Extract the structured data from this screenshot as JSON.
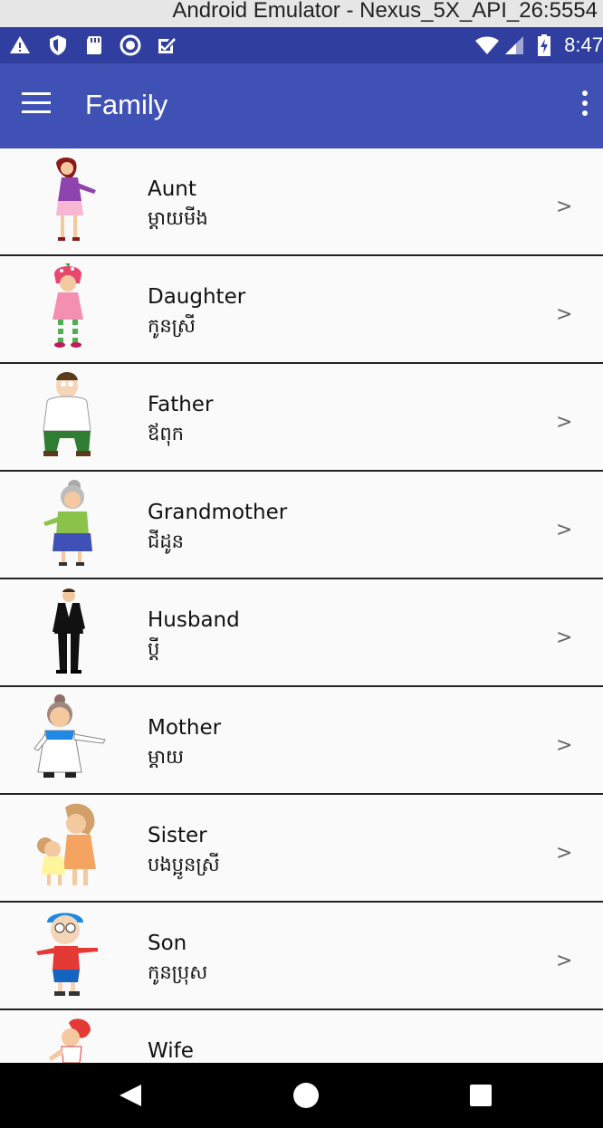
{
  "window": {
    "title": "Android Emulator - Nexus_5X_API_26:5554"
  },
  "status_bar": {
    "time": "8:47",
    "left_icons": [
      "warning-icon",
      "shield-icon",
      "sd-card-icon",
      "sync-circle-icon",
      "checkbox-icon"
    ],
    "right_icons": [
      "wifi-icon",
      "cell-signal-icon",
      "battery-charging-icon"
    ]
  },
  "app_bar": {
    "title": "Family",
    "background": "#3f51b5",
    "status_color": "#303f9f"
  },
  "items": [
    {
      "name": "Aunt",
      "khmer": "ម្ដាយមីង",
      "chevron": ">",
      "image": "aunt-illustration"
    },
    {
      "name": "Daughter",
      "khmer": "កូនស្រី",
      "chevron": ">",
      "image": "daughter-illustration"
    },
    {
      "name": "Father",
      "khmer": "ឪពុក",
      "chevron": ">",
      "image": "father-illustration"
    },
    {
      "name": "Grandmother",
      "khmer": "ជីដូន",
      "chevron": ">",
      "image": "grandmother-illustration"
    },
    {
      "name": "Husband",
      "khmer": "ប្ដី",
      "chevron": ">",
      "image": "husband-illustration"
    },
    {
      "name": "Mother",
      "khmer": "ម្ដាយ",
      "chevron": ">",
      "image": "mother-illustration"
    },
    {
      "name": "Sister",
      "khmer": "បងប្អូនស្រី",
      "chevron": ">",
      "image": "sister-illustration"
    },
    {
      "name": "Son",
      "khmer": "កូនប្រុស",
      "chevron": ">",
      "image": "son-illustration"
    },
    {
      "name": "Wife",
      "khmer": "",
      "chevron": "",
      "image": "wife-illustration"
    }
  ],
  "nav_bar": {
    "icons": [
      "back-icon",
      "home-icon",
      "recents-icon"
    ]
  }
}
